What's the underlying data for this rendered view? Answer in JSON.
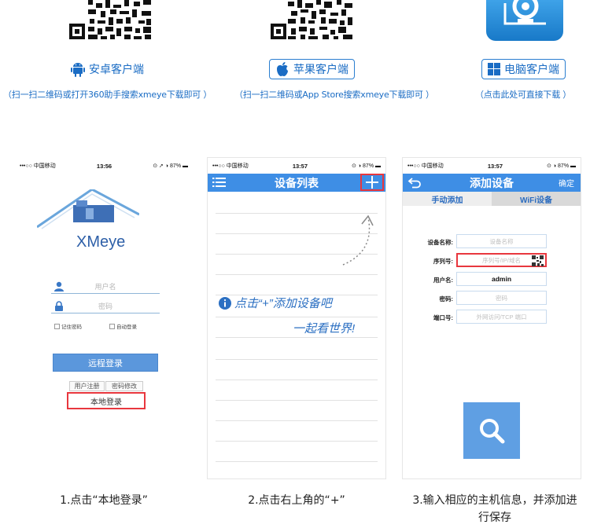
{
  "downloads": {
    "android": {
      "label": "安卓客户端",
      "note": "（扫一扫二维码或打开360助手搜索xmeye下载即可 ）"
    },
    "ios": {
      "label": "苹果客户端",
      "note": "（扫一扫二维码或App Store搜索xmeye下载即可 ）"
    },
    "pc": {
      "label": "电脑客户端",
      "note": "（点击此处可直接下载 ）"
    }
  },
  "phones": [
    {
      "status": {
        "carrier": "•••○○ 中国移动",
        "time": "13:56",
        "battery": "87%"
      },
      "logo": "XMeye",
      "username_placeholder": "用户名",
      "password_placeholder": "密码",
      "remember": "记住密码",
      "autologin": "自动登录",
      "remote_login": "远程登录",
      "register": "用户注册",
      "change_password": "密码修改",
      "local_login": "本地登录"
    },
    {
      "status": {
        "carrier": "•••○○ 中国移动",
        "time": "13:57",
        "battery": "87%"
      },
      "title": "设备列表",
      "hint1": "点击“+”添加设备吧",
      "hint2": "一起看世界!"
    },
    {
      "status": {
        "carrier": "•••○○ 中国移动",
        "time": "13:57",
        "battery": "87%"
      },
      "title": "添加设备",
      "confirm": "确定",
      "tab_manual": "手动添加",
      "tab_wifi": "WiFi设备",
      "fields": [
        {
          "label": "设备名称:",
          "value": "设备名称"
        },
        {
          "label": "序列号:",
          "value": "序列号/IP/域名"
        },
        {
          "label": "用户名:",
          "value": "admin"
        },
        {
          "label": "密码:",
          "value": "密码"
        },
        {
          "label": "端口号:",
          "value": "外网访问/TCP 端口"
        }
      ]
    }
  ],
  "captions": {
    "step1": "1.点击“本地登录”",
    "step2": "2.点击右上角的“+”",
    "step3": "3.输入相应的主机信息，并添加进行保存"
  },
  "colors": {
    "accent": "#3e8ee5",
    "highlight": "#e8373e",
    "link": "#1a6cc4"
  }
}
